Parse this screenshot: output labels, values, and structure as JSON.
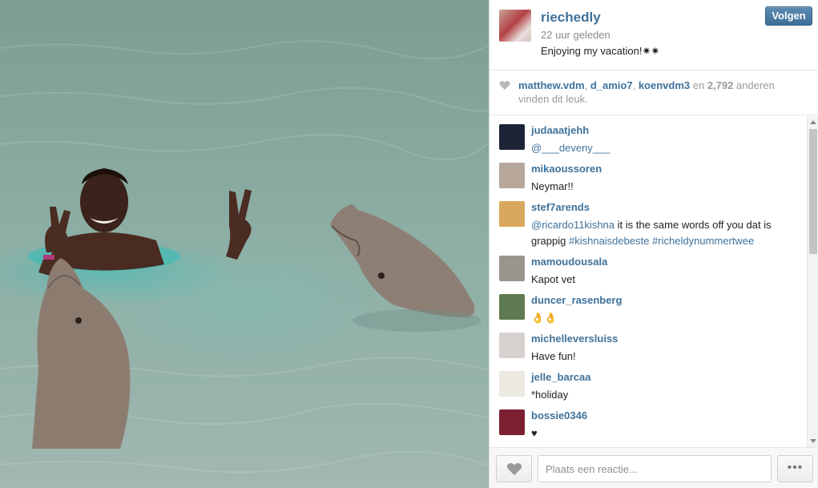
{
  "post": {
    "username": "riechedly",
    "time_ago": "22 uur geleden",
    "caption": "Enjoying my vacation!✷✷",
    "follow_label": "Volgen"
  },
  "likes": {
    "users": [
      "matthew.vdm",
      "d_amio7",
      "koenvdm3"
    ],
    "separator": ", ",
    "and_text": " en ",
    "count": "2,792",
    "suffix": " anderen vinden dit leuk."
  },
  "comments": [
    {
      "username": "judaaatjehh",
      "parts": [
        {
          "t": "@___deveny___",
          "k": "mention"
        }
      ],
      "avatar_color": "#1d2438"
    },
    {
      "username": "mikaoussoren",
      "parts": [
        {
          "t": "Neymar!!",
          "k": "text"
        }
      ],
      "avatar_color": "#b7a79a"
    },
    {
      "username": "stef7arends",
      "parts": [
        {
          "t": "@ricardo11kishna",
          "k": "mention"
        },
        {
          "t": " it is the same words off you dat is grappig ",
          "k": "text"
        },
        {
          "t": "#kishnaisdebeste",
          "k": "tag"
        },
        {
          "t": " ",
          "k": "text"
        },
        {
          "t": "#richeldynummertwee",
          "k": "tag"
        }
      ],
      "avatar_color": "#d9a85c"
    },
    {
      "username": "mamoudousala",
      "parts": [
        {
          "t": "Kapot vet",
          "k": "text"
        }
      ],
      "avatar_color": "#9a968f"
    },
    {
      "username": "duncer_rasenberg",
      "parts": [
        {
          "t": "👌👌",
          "k": "text"
        }
      ],
      "avatar_color": "#5f7a52"
    },
    {
      "username": "michelleversluiss",
      "parts": [
        {
          "t": "Have fun! ",
          "k": "text"
        }
      ],
      "avatar_color": "#d7d2d0"
    },
    {
      "username": "jelle_barcaa",
      "parts": [
        {
          "t": "*holiday",
          "k": "text"
        }
      ],
      "avatar_color": "#ece8e2"
    },
    {
      "username": "bossie0346",
      "parts": [
        {
          "t": "♥",
          "k": "text"
        }
      ],
      "avatar_color": "#7b2030"
    }
  ],
  "input": {
    "placeholder": "Plaats een reactie..."
  },
  "more_label": "•••",
  "icons": {
    "like": "heart-icon",
    "likes_indicator": "heart-small-icon",
    "more": "ellipsis-icon",
    "scroll_up": "chevron-up-icon",
    "scroll_down": "chevron-down-icon"
  },
  "colors": {
    "link": "#3f729b",
    "button": "#3f6f98",
    "muted": "#8a8a8a"
  }
}
